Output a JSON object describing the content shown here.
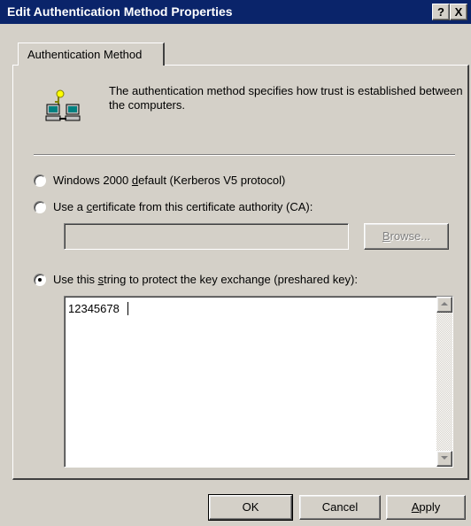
{
  "window": {
    "title": "Edit Authentication Method Properties",
    "help_glyph": "?",
    "close_glyph": "X"
  },
  "tabs": [
    {
      "label": "Authentication Method"
    }
  ],
  "info": {
    "icon": "network-computers-with-key-icon",
    "description": "The authentication method specifies how trust is established between the computers."
  },
  "options": {
    "kerberos": {
      "pre": "Windows 2000 ",
      "accel": "d",
      "post": "efault (Kerberos V5 protocol)",
      "checked": false
    },
    "certificate": {
      "pre": "Use a ",
      "accel": "c",
      "post": "ertificate from this certificate authority (CA):",
      "checked": false,
      "ca_value": ""
    },
    "browse": {
      "accel": "B",
      "post": "rowse...",
      "enabled": false
    },
    "preshared": {
      "pre": "Use this ",
      "accel": "s",
      "post": "tring to protect the key exchange (preshared key):",
      "checked": true,
      "key_value": "12345678"
    }
  },
  "buttons": {
    "ok": "OK",
    "cancel": "Cancel",
    "apply": {
      "accel": "A",
      "post": "pply"
    }
  }
}
